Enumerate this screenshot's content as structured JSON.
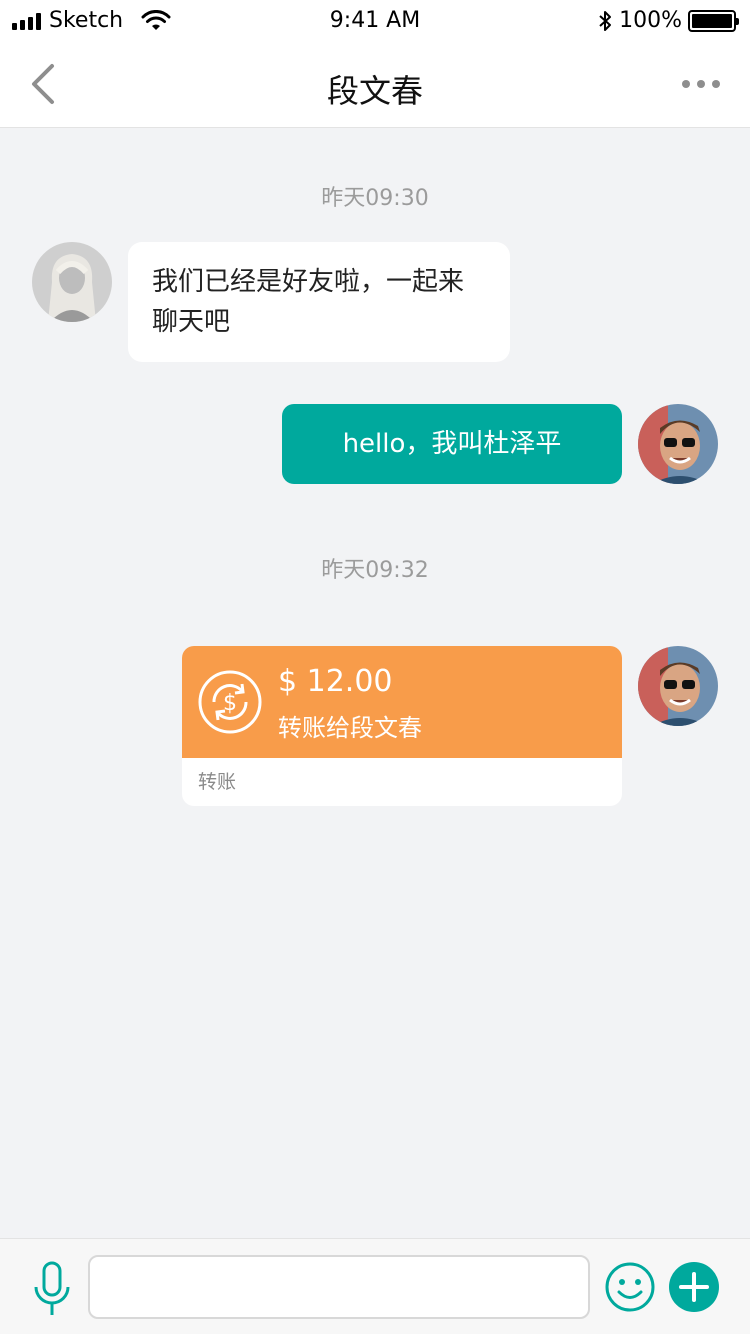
{
  "status_bar": {
    "carrier": "Sketch",
    "time": "9:41 AM",
    "battery": "100%",
    "icons": [
      "signal-icon",
      "wifi-icon",
      "bluetooth-icon",
      "battery-icon"
    ]
  },
  "nav": {
    "title": "段文春",
    "icons": [
      "back-chevron-icon",
      "more-dots-icon"
    ]
  },
  "chat": {
    "timestamp_1": "昨天09:30",
    "message_in": "我们已经是好友啦，一起来聊天吧",
    "message_out": "hello，我叫杜泽平",
    "timestamp_2": "昨天09:32",
    "transfer": {
      "amount": "$ 12.00",
      "description": "转账给段文春",
      "footer": "转账"
    }
  },
  "input_bar": {
    "placeholder": "",
    "icons": [
      "microphone-icon",
      "smiley-icon",
      "plus-icon"
    ]
  },
  "colors": {
    "accent": "#00a99d",
    "transfer_card": "#f89c4a",
    "background": "#f2f3f5"
  }
}
